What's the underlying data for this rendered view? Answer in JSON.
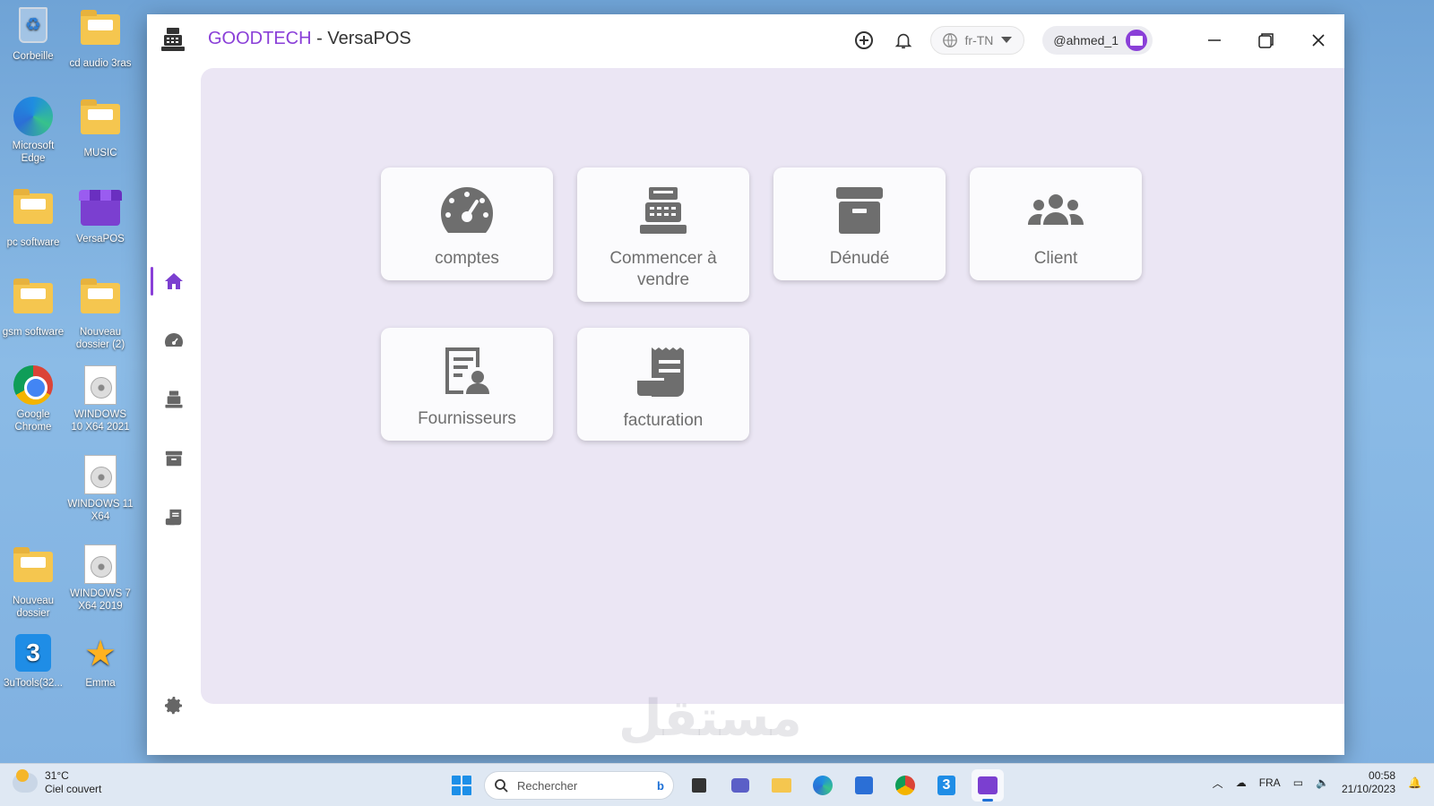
{
  "desktop": {
    "icons": [
      {
        "label": "Corbeille",
        "icon": "recycle-bin-icon"
      },
      {
        "label": "cd audio 3ras",
        "icon": "folder-icon"
      },
      {
        "label": "Microsoft Edge",
        "icon": "edge-icon"
      },
      {
        "label": "MUSIC",
        "icon": "folder-icon"
      },
      {
        "label": "pc software",
        "icon": "folder-icon"
      },
      {
        "label": "VersaPOS",
        "icon": "store-icon"
      },
      {
        "label": "gsm software",
        "icon": "folder-icon"
      },
      {
        "label": "Nouveau dossier (2)",
        "icon": "folder-icon"
      },
      {
        "label": "Google Chrome",
        "icon": "chrome-icon"
      },
      {
        "label": "WINDOWS 10 X64 2021",
        "icon": "disc-image-icon"
      },
      {
        "label": "WINDOWS 11 X64",
        "icon": "disc-image-icon"
      },
      {
        "label": "Nouveau dossier",
        "icon": "folder-icon"
      },
      {
        "label": "WINDOWS 7 X64 2019",
        "icon": "disc-image-icon"
      },
      {
        "label": "3uTools(32...",
        "icon": "3utools-icon"
      },
      {
        "label": "Emma",
        "icon": "star-icon"
      }
    ]
  },
  "app": {
    "brand": "GOODTECH",
    "title_separator": " - ",
    "title": "VersaPOS",
    "language": "fr-TN",
    "username": "@ahmed_1",
    "accent_color": "#8a3fd8"
  },
  "sidebar": {
    "items": [
      {
        "name": "home",
        "icon": "home-icon",
        "active": true
      },
      {
        "name": "dashboard",
        "icon": "gauge-icon",
        "active": false
      },
      {
        "name": "cash-register",
        "icon": "cash-register-icon",
        "active": false
      },
      {
        "name": "archive",
        "icon": "archive-icon",
        "active": false
      },
      {
        "name": "invoice",
        "icon": "receipt-icon",
        "active": false
      }
    ],
    "settings_icon": "gear-icon"
  },
  "dashboard_cards": [
    {
      "label": "comptes",
      "icon": "gauge-icon"
    },
    {
      "label": "Commencer à vendre",
      "icon": "cash-register-icon"
    },
    {
      "label": "Dénudé",
      "icon": "archive-icon"
    },
    {
      "label": "Client",
      "icon": "users-icon"
    },
    {
      "label": "Fournisseurs",
      "icon": "supplier-document-icon"
    },
    {
      "label": "facturation",
      "icon": "receipt-icon"
    }
  ],
  "taskbar": {
    "weather_temp": "31°C",
    "weather_desc": "Ciel couvert",
    "search_placeholder": "Rechercher",
    "language": "FRA",
    "time": "00:58",
    "date": "21/10/2023"
  }
}
